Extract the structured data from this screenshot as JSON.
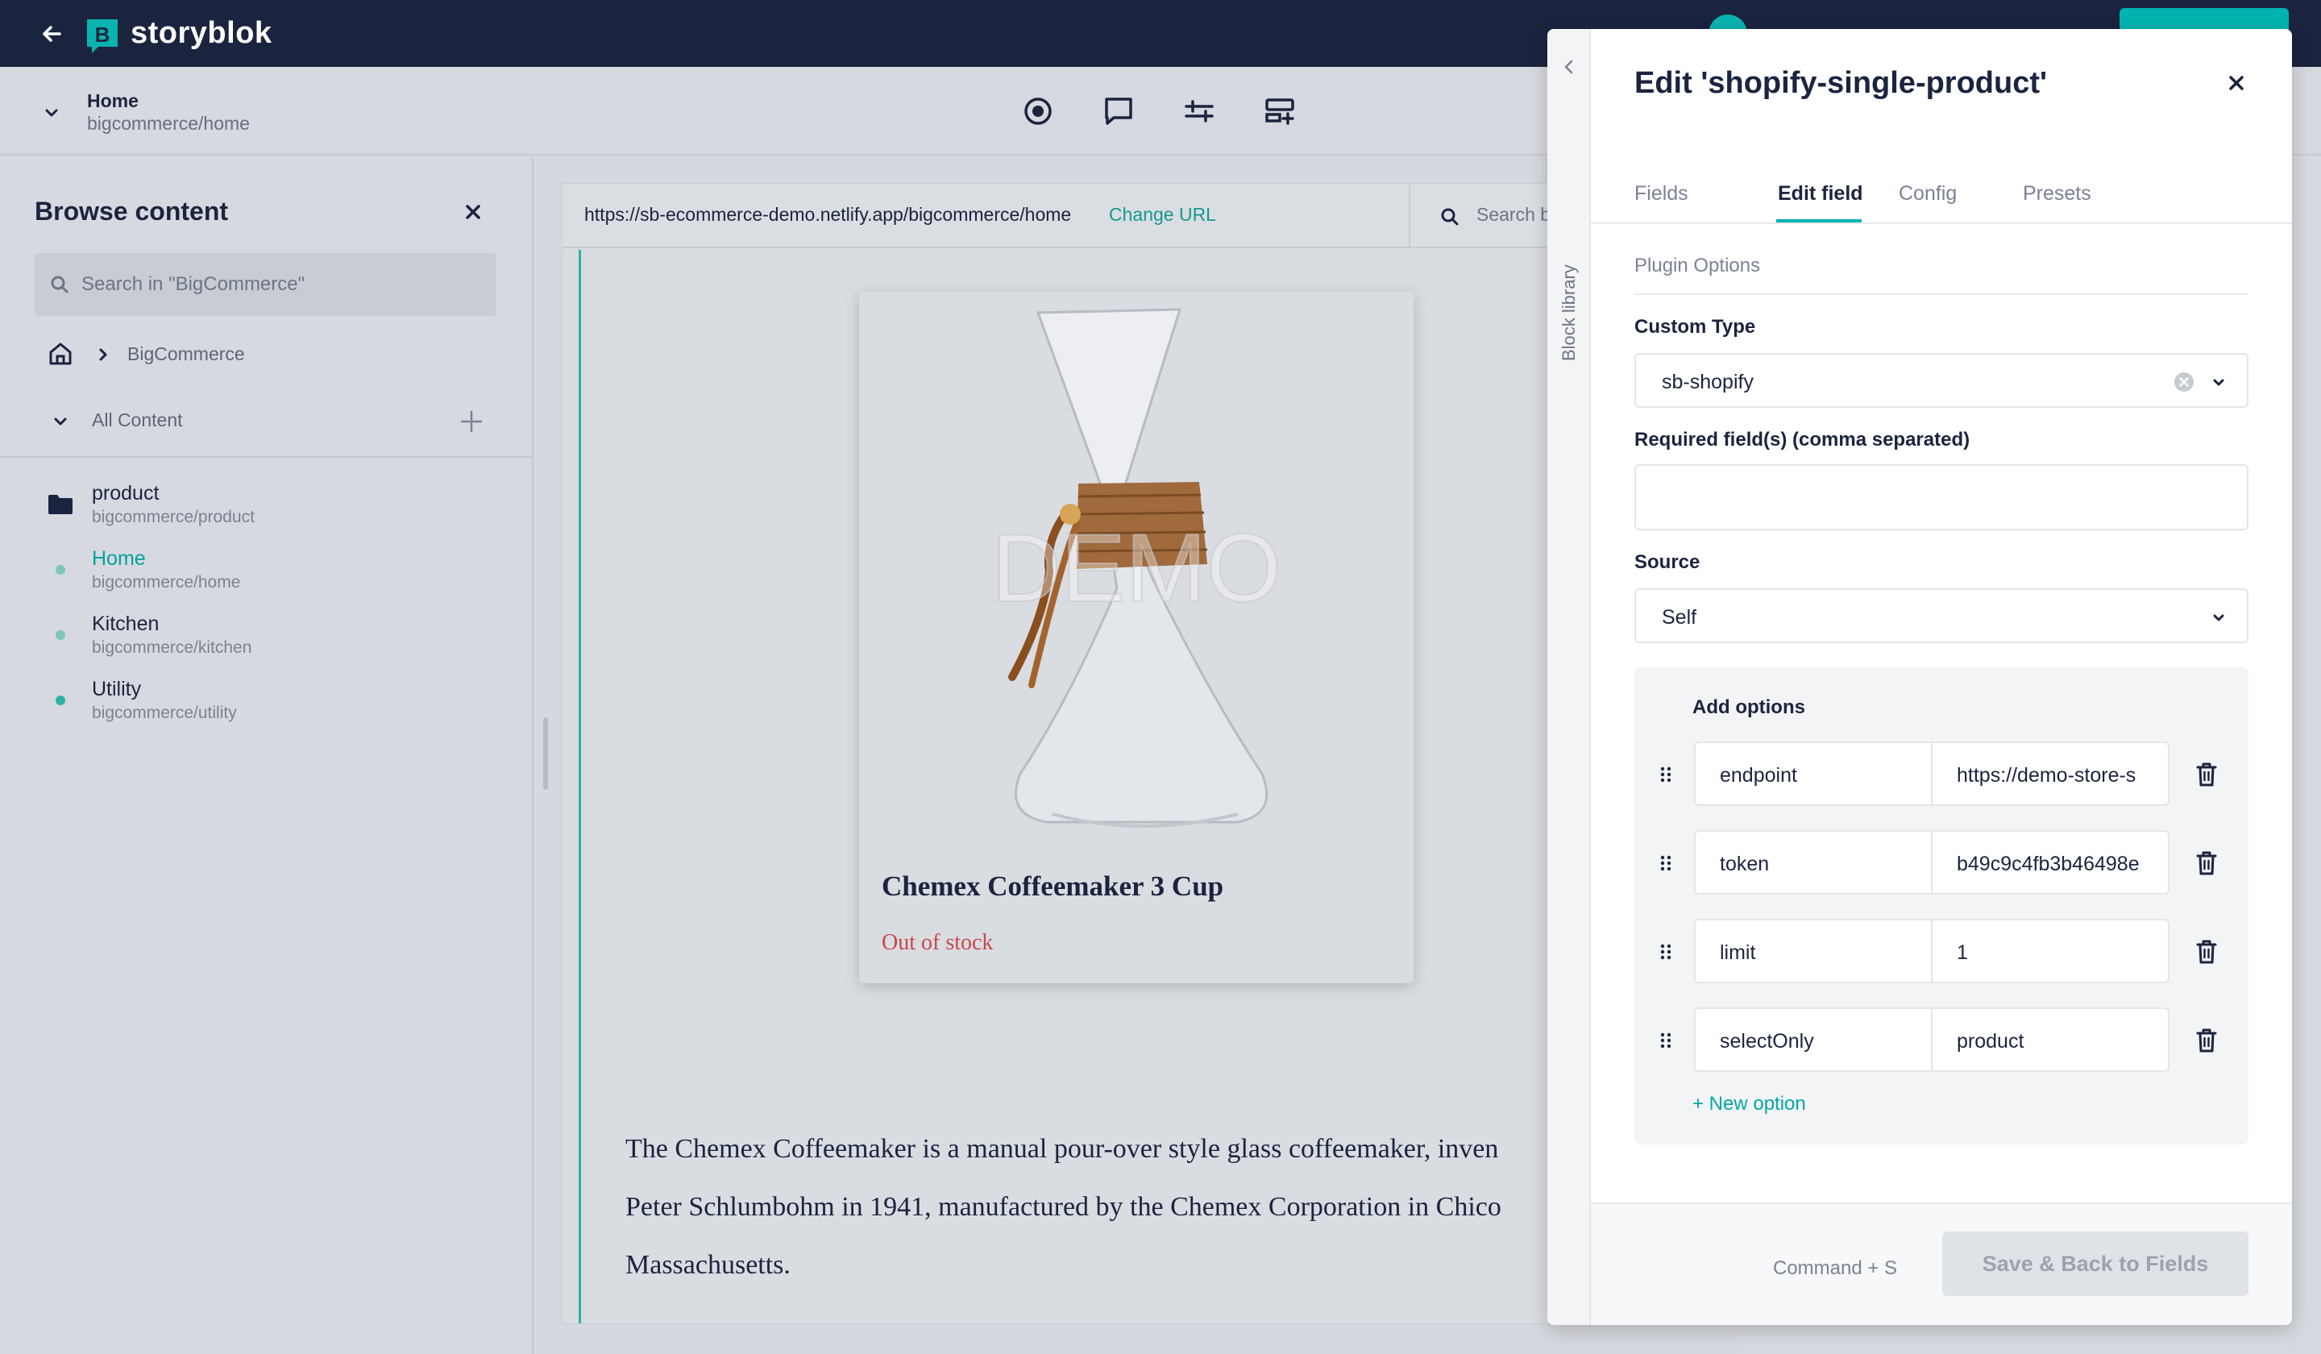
{
  "app": {
    "name": "storyblok"
  },
  "story": {
    "title": "Home",
    "slug": "bigcommerce/home"
  },
  "sidebar": {
    "title": "Browse content",
    "search_placeholder": "Search in \"BigCommerce\"",
    "breadcrumb": "BigCommerce",
    "all_content": "All Content",
    "items": [
      {
        "name": "product",
        "slug": "bigcommerce/product",
        "type": "folder"
      },
      {
        "name": "Home",
        "slug": "bigcommerce/home",
        "type": "story",
        "active": true
      },
      {
        "name": "Kitchen",
        "slug": "bigcommerce/kitchen",
        "type": "story"
      },
      {
        "name": "Utility",
        "slug": "bigcommerce/utility",
        "type": "story"
      }
    ]
  },
  "preview": {
    "url": "https://sb-ecommerce-demo.netlify.app/bigcommerce/home",
    "change_url": "Change URL",
    "search_placeholder": "Search b",
    "product_title": "Chemex Coffeemaker 3 Cup",
    "stock": "Out of stock",
    "watermark": "DEMO",
    "description_lines": [
      "The Chemex Coffeemaker is a manual pour-over style glass coffeemaker, inven",
      "Peter Schlumbohm in 1941, manufactured by the Chemex Corporation in Chico",
      "Massachusetts."
    ]
  },
  "panel": {
    "title": "Edit 'shopify-single-product'",
    "rail_label": "Block library",
    "tabs": [
      "Fields",
      "Edit field",
      "Config",
      "Presets"
    ],
    "active_tab": "Edit field",
    "section": "Plugin Options",
    "custom_type_label": "Custom Type",
    "custom_type_value": "sb-shopify",
    "required_label": "Required field(s) (comma separated)",
    "required_value": "",
    "source_label": "Source",
    "source_value": "Self",
    "options_title": "Add options",
    "options": [
      {
        "key": "endpoint",
        "value": "https://demo-store-s"
      },
      {
        "key": "token",
        "value": "b49c9c4fb3b46498e"
      },
      {
        "key": "limit",
        "value": "1"
      },
      {
        "key": "selectOnly",
        "value": "product"
      }
    ],
    "new_option": "+ New option",
    "shortcut": "Command + S",
    "save_label": "Save & Back to Fields"
  },
  "colors": {
    "topbar": "#1b243f",
    "accent": "#00b3b0",
    "out_of_stock": "#c94848"
  }
}
